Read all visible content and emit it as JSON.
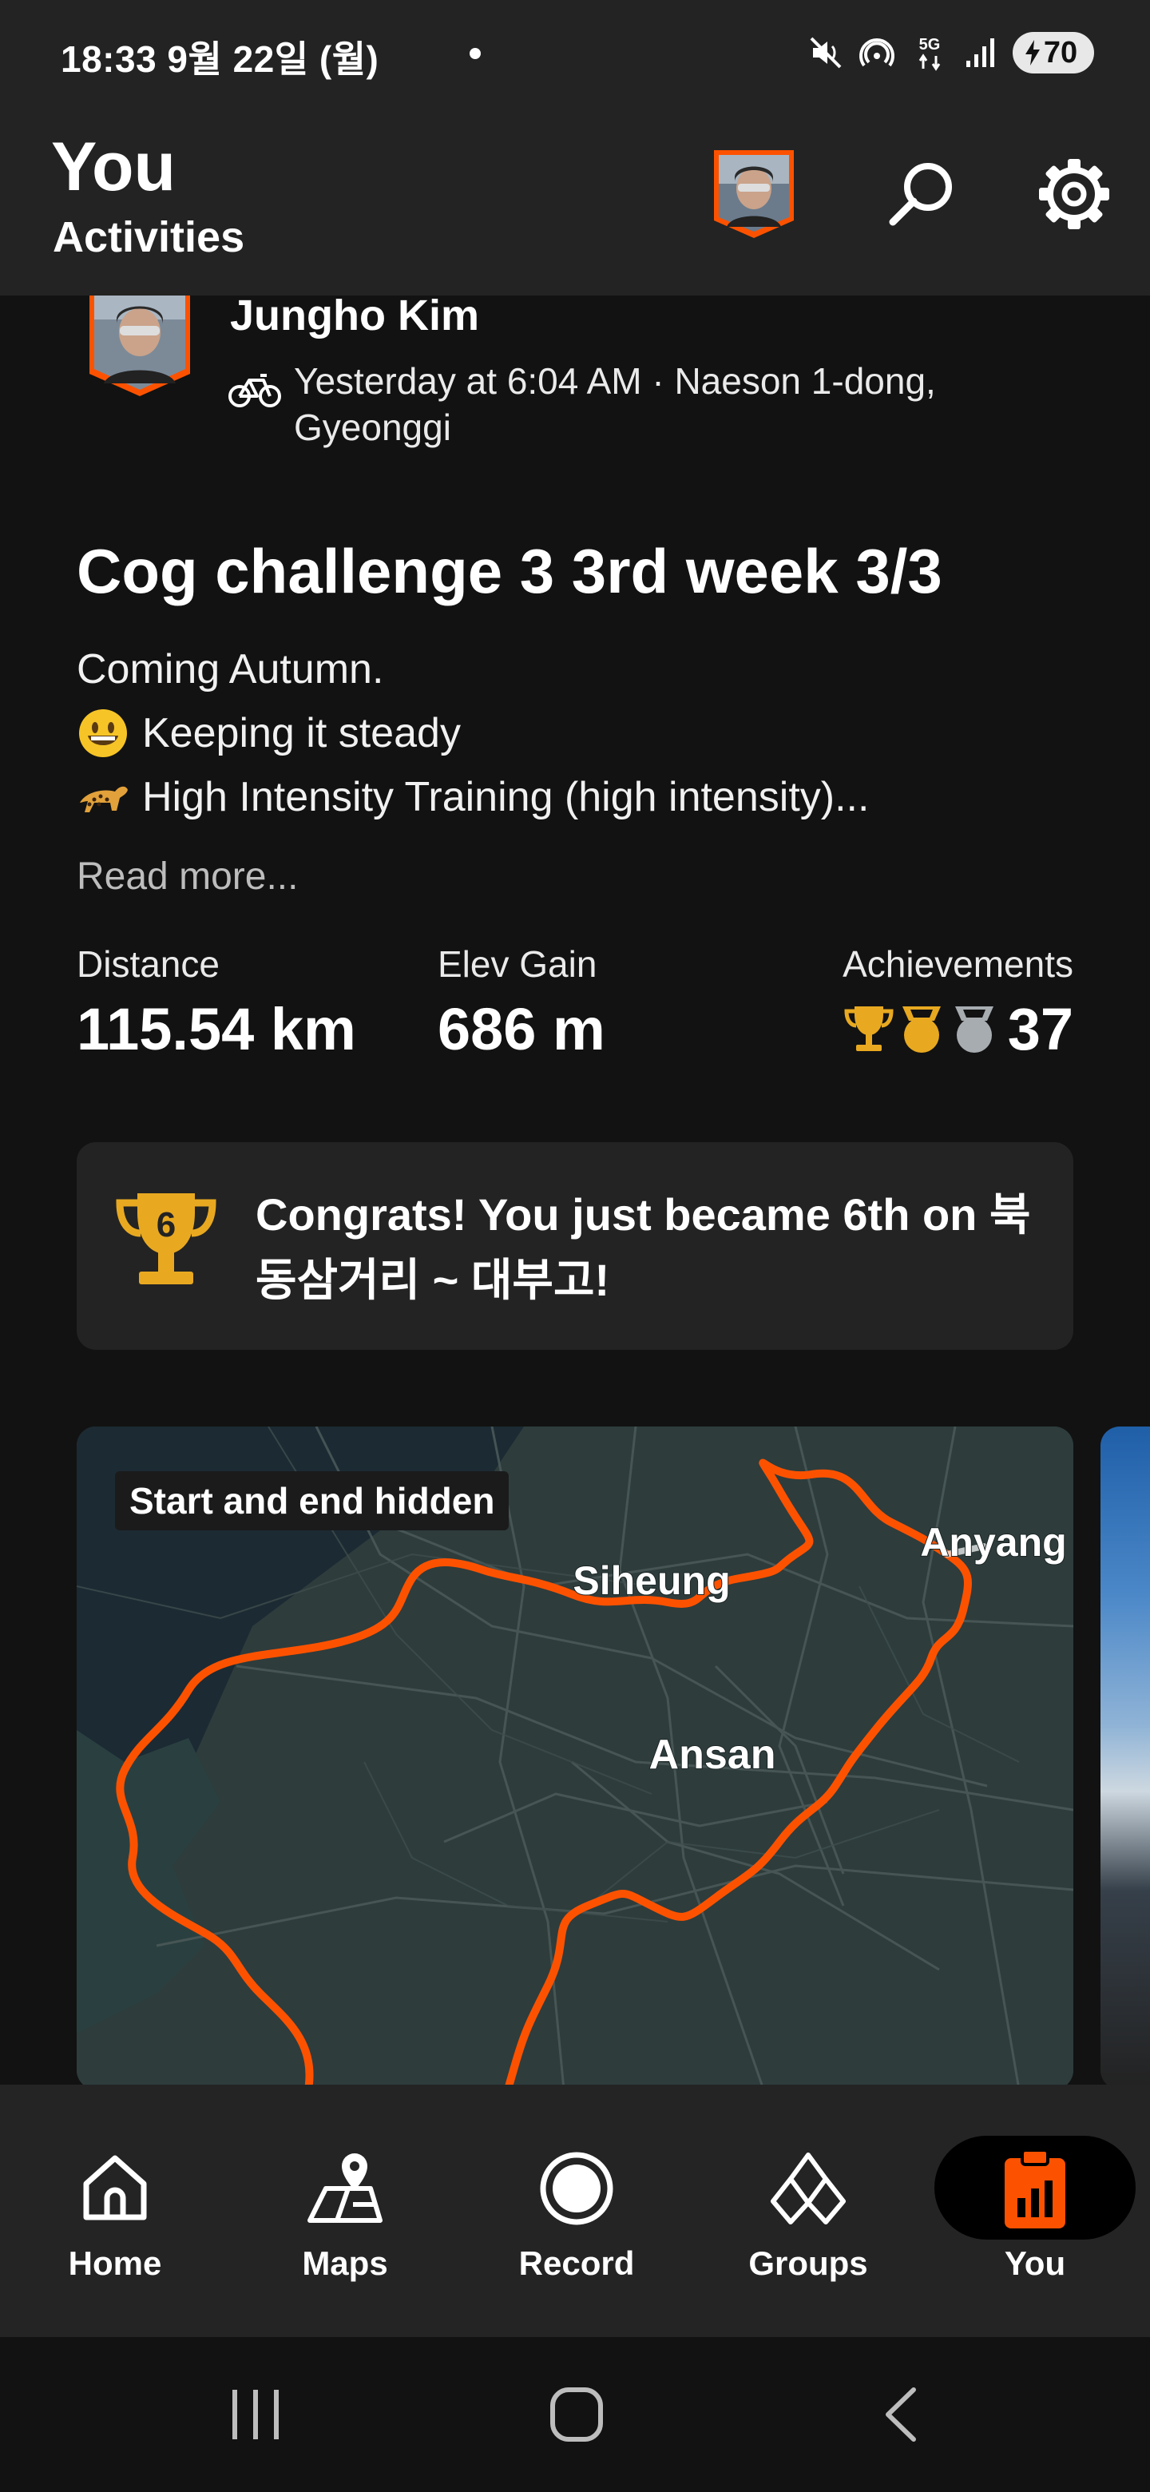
{
  "status_bar": {
    "time": "18:33  9월 22일 (월)",
    "battery": "70",
    "network": "5G"
  },
  "header": {
    "title": "You",
    "subtitle": "Activities"
  },
  "activity": {
    "athlete_name": "Jungho Kim",
    "meta": "Yesterday at 6:04 AM · Naeson 1-dong, Gyeonggi",
    "title": "Cog challenge 3 3rd week 3/3",
    "description": [
      {
        "emoji": "",
        "text": "Coming Autumn."
      },
      {
        "emoji": "grinning-face",
        "text": "Keeping it steady"
      },
      {
        "emoji": "leopard",
        "text": "High Intensity Training (high intensity)..."
      }
    ],
    "read_more": "Read more...",
    "stats": {
      "distance_label": "Distance",
      "distance_value": "115.54 km",
      "elev_label": "Elev Gain",
      "elev_value": "686 m",
      "achievements_label": "Achievements",
      "achievements_count": "37"
    },
    "congrats": {
      "rank": "6",
      "text": "Congrats! You just became 6th on 북동삼거리 ~ 대부고!"
    },
    "map": {
      "badge": "Start and end hidden",
      "places": [
        "Siheung",
        "Anyang",
        "Ansan"
      ],
      "route_color": "#fc5200"
    }
  },
  "bottom_nav": [
    {
      "label": "Home",
      "icon": "home-icon"
    },
    {
      "label": "Maps",
      "icon": "maps-icon"
    },
    {
      "label": "Record",
      "icon": "record-icon"
    },
    {
      "label": "Groups",
      "icon": "groups-icon"
    },
    {
      "label": "You",
      "icon": "you-icon",
      "active": true
    }
  ],
  "colors": {
    "accent": "#fc5200",
    "background": "#121212",
    "surface": "#232323",
    "trophy_gold": "#e8a921"
  }
}
